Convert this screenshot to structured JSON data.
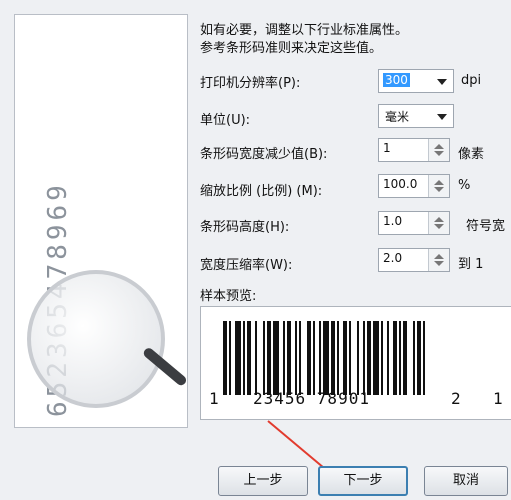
{
  "intro": {
    "line1": "如有必要，调整以下行业标准属性。",
    "line2": "参考条形码准则来决定这些值。"
  },
  "decor": {
    "digits": "652365478969"
  },
  "form": {
    "resolution": {
      "label": "打印机分辨率(P):",
      "value": "300",
      "unit": "dpi"
    },
    "unit_field": {
      "label": "单位(U):",
      "value": "毫米"
    },
    "bar_reduction": {
      "label": "条形码宽度减少值(B):",
      "value": "1",
      "unit": "像素"
    },
    "scale": {
      "label": "缩放比例 (比例) (M):",
      "value": "100.0",
      "unit": "%"
    },
    "height": {
      "label": "条形码高度(H):",
      "value": "1.0",
      "unit": "符号宽"
    },
    "width_ratio": {
      "label": "宽度压缩率(W):",
      "value": "2.0",
      "unit": "到 1"
    }
  },
  "preview": {
    "label": "样本预览:",
    "left_digit": "1",
    "main_digits": "23456 78901",
    "right_digit_1": "2",
    "right_digit_2": "1"
  },
  "buttons": {
    "back": "上一步",
    "next": "下一步",
    "cancel": "取消"
  },
  "colors": {
    "accent": "#3c7fb1",
    "arrow": "#e23b2e",
    "selection": "#3399ff"
  }
}
